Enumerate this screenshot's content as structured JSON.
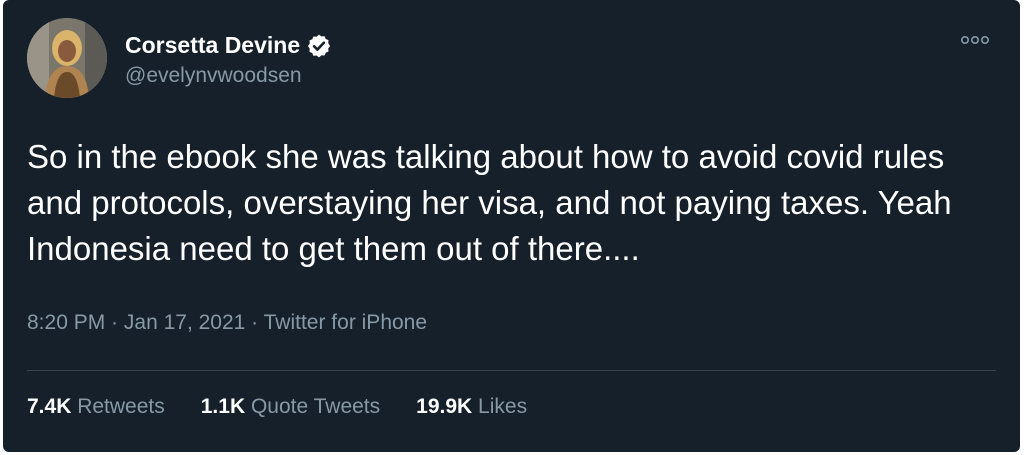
{
  "tweet": {
    "author_name": "Corsetta Devine",
    "handle": "@evelynvwoodsen",
    "text": "So in the ebook she was talking about how to avoid covid rules and protocols, overstaying her visa, and not paying taxes. Yeah Indonesia need to get them out of there....",
    "time": "8:20 PM",
    "date": "Jan 17, 2021",
    "source": "Twitter for iPhone",
    "separator": " · "
  },
  "stats": {
    "retweets_count": "7.4K",
    "retweets_label": "Retweets",
    "quotes_count": "1.1K",
    "quotes_label": "Quote Tweets",
    "likes_count": "19.9K",
    "likes_label": "Likes"
  },
  "icons": {
    "verified": "verified-badge-icon",
    "more": "more-options-icon"
  },
  "colors": {
    "background": "#15202b",
    "primary_text": "#ffffff",
    "secondary_text": "#8899a6",
    "divider": "#38444d"
  }
}
